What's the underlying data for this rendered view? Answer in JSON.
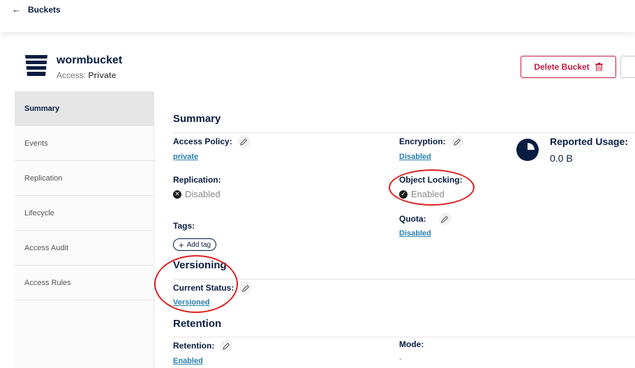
{
  "topbar": {
    "back_label": "Buckets"
  },
  "bucket": {
    "name": "wormbucket",
    "access_prefix": "Access:",
    "access_value": "Private"
  },
  "actions": {
    "delete_label": "Delete Bucket"
  },
  "sidebar": {
    "items": [
      {
        "label": "Summary",
        "active": true
      },
      {
        "label": "Events"
      },
      {
        "label": "Replication"
      },
      {
        "label": "Lifecycle"
      },
      {
        "label": "Access Audit"
      },
      {
        "label": "Access Rules"
      }
    ]
  },
  "summary": {
    "title": "Summary",
    "access_policy": {
      "label": "Access Policy:",
      "value": "private"
    },
    "encryption": {
      "label": "Encryption:",
      "value": "Disabled"
    },
    "reported_usage": {
      "label": "Reported Usage:",
      "value": "0.0 B"
    },
    "replication": {
      "label": "Replication:",
      "value": "Disabled"
    },
    "object_locking": {
      "label": "Object Locking:",
      "value": "Enabled"
    },
    "tags": {
      "label": "Tags:",
      "add_label": "Add tag"
    },
    "quota": {
      "label": "Quota:",
      "value": "Disabled"
    }
  },
  "versioning": {
    "title": "Versioning",
    "current_status": {
      "label": "Current Status:",
      "value": "Versioned"
    }
  },
  "retention": {
    "title": "Retention",
    "retention": {
      "label": "Retention:",
      "value": "Enabled"
    },
    "mode": {
      "label": "Mode:",
      "value": "-"
    }
  },
  "colors": {
    "navy": "#081c42",
    "link": "#2781b0",
    "danger": "#c51b3f",
    "annotation": "#e02020"
  },
  "icons": [
    "arrow-left-icon",
    "bucket-icon",
    "trash-icon",
    "pencil-icon",
    "usage-pie-icon",
    "x-circle-icon",
    "check-circle-icon",
    "plus-icon"
  ]
}
